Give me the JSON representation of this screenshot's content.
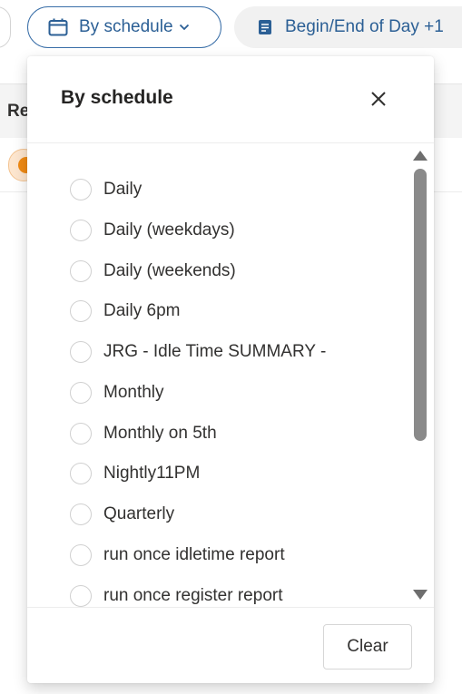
{
  "toolbar": {
    "schedule_chip_label": "By schedule",
    "begin_chip_label": "Begin/End of Day +1"
  },
  "background": {
    "header_text": "Re"
  },
  "dropdown": {
    "title": "By schedule",
    "options": [
      "Daily",
      "Daily (weekdays)",
      "Daily (weekends)",
      "Daily 6pm",
      "JRG - Idle Time SUMMARY -",
      "Monthly",
      "Monthly on 5th",
      "Nightly11PM",
      "Quarterly",
      "run once idletime report",
      "run once register report"
    ],
    "clear_label": "Clear"
  },
  "colors": {
    "accent": "#2b5f95",
    "chip_border": "#3a6fa8",
    "badge": "#f08a13"
  }
}
